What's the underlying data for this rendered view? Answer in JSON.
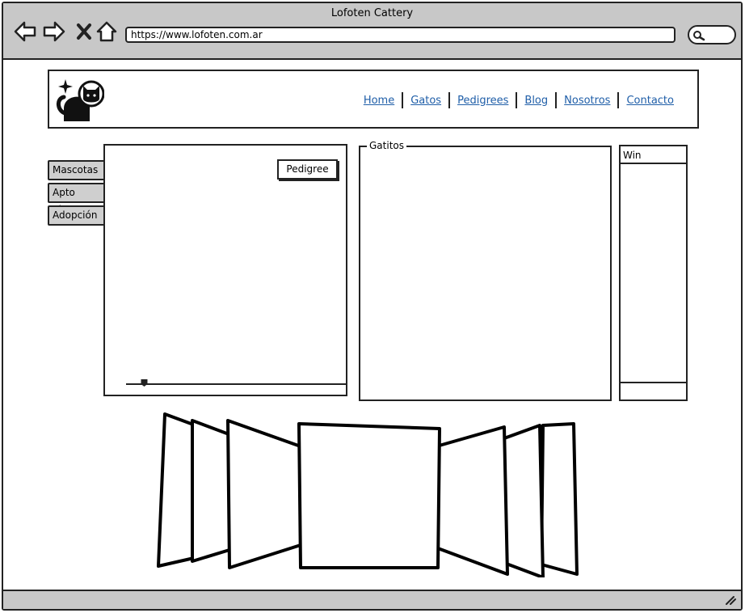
{
  "browser": {
    "title": "Lofoten Cattery",
    "url": "https://www.lofoten.com.ar",
    "back_icon": "back-arrow-icon",
    "forward_icon": "forward-arrow-icon",
    "stop_icon": "close-icon",
    "home_icon": "home-icon",
    "search_icon": "search-icon"
  },
  "header": {
    "logo_icon": "cat-logo-icon",
    "nav": [
      "Home",
      "Gatos",
      "Pedigrees",
      "Blog",
      "Nosotros",
      "Contacto"
    ],
    "link_color": "#1f5ea8"
  },
  "vtabs": [
    "Mascotas",
    "Apto Show",
    "Adopción"
  ],
  "tab_panel": {
    "button_label": "Pedigree",
    "slider_value": 0.07
  },
  "fieldset": {
    "legend": "Gatitos"
  },
  "window_widget": {
    "title": "Win"
  },
  "colors": {
    "chrome": "#c8c8c8",
    "tab": "#cfcfcf",
    "stroke": "#222222"
  }
}
